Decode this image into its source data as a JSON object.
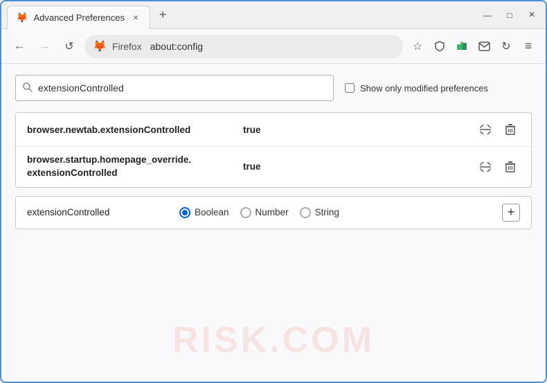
{
  "window": {
    "title": "Advanced Preferences",
    "close_label": "×",
    "minimize_label": "—",
    "maximize_label": "□",
    "new_tab_label": "+"
  },
  "browser": {
    "brand": "Firefox",
    "url": "about:config"
  },
  "toolbar": {
    "back_label": "←",
    "forward_label": "→",
    "reload_label": "↺",
    "bookmark_icon": "☆",
    "shield_icon": "🛡",
    "extension_icon": "🧩",
    "email_icon": "✉",
    "sync_icon": "↻",
    "menu_icon": "≡"
  },
  "search": {
    "value": "extensionControlled",
    "placeholder": "extensionControlled",
    "show_modified_label": "Show only modified preferences"
  },
  "preferences": [
    {
      "name": "browser.newtab.extensionControlled",
      "value": "true"
    },
    {
      "name_line1": "browser.startup.homepage_override.",
      "name_line2": "extensionControlled",
      "value": "true"
    }
  ],
  "new_pref": {
    "name": "extensionControlled",
    "types": [
      {
        "label": "Boolean",
        "selected": true
      },
      {
        "label": "Number",
        "selected": false
      },
      {
        "label": "String",
        "selected": false
      }
    ],
    "add_label": "+"
  },
  "watermark": "RISK.COM"
}
